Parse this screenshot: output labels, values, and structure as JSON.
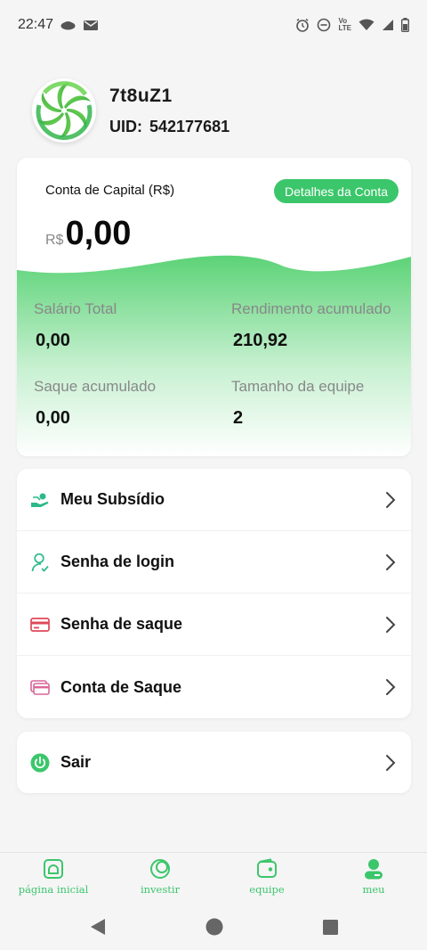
{
  "status_bar": {
    "time": "22:47",
    "left_icons": [
      "cloud-icon",
      "mail-icon"
    ],
    "right_icons": [
      "alarm-icon",
      "dnd-icon",
      "volte-icon",
      "wifi-icon",
      "signal-icon",
      "battery-icon"
    ],
    "volte_text_1": "Vo",
    "volte_text_2": "LTE"
  },
  "profile": {
    "username": "7t8uZ1",
    "uid_label": "UID:",
    "uid_value": "542177681"
  },
  "capital": {
    "title": "Conta de Capital (R$)",
    "details_button": "Detalhes da Conta",
    "currency": "R$",
    "amount": "0,00",
    "stats": [
      {
        "label": "Salário Total",
        "value": "0,00"
      },
      {
        "label": "Rendimento acumulado",
        "value": "210,92"
      },
      {
        "label": "Saque acumulado",
        "value": "0,00"
      },
      {
        "label": "Tamanho da equipe",
        "value": "2"
      }
    ],
    "accent": "#3cc66b"
  },
  "menu": {
    "items": [
      {
        "label": "Meu Subsídio",
        "icon": "subsidy-icon"
      },
      {
        "label": "Senha de login",
        "icon": "user-lock-icon"
      },
      {
        "label": "Senha de saque",
        "icon": "card-icon"
      },
      {
        "label": "Conta de Saque",
        "icon": "wallet-card-icon"
      }
    ],
    "logout": {
      "label": "Sair",
      "icon": "power-icon"
    }
  },
  "bottom_nav": {
    "items": [
      {
        "label": "página inicial",
        "icon": "home-icon"
      },
      {
        "label": "investir",
        "icon": "invest-icon"
      },
      {
        "label": "equipe",
        "icon": "wallet-icon"
      },
      {
        "label": "meu",
        "icon": "profile-icon",
        "active": true
      }
    ]
  },
  "system_nav": [
    "back-icon",
    "home-circle-icon",
    "recents-icon"
  ]
}
